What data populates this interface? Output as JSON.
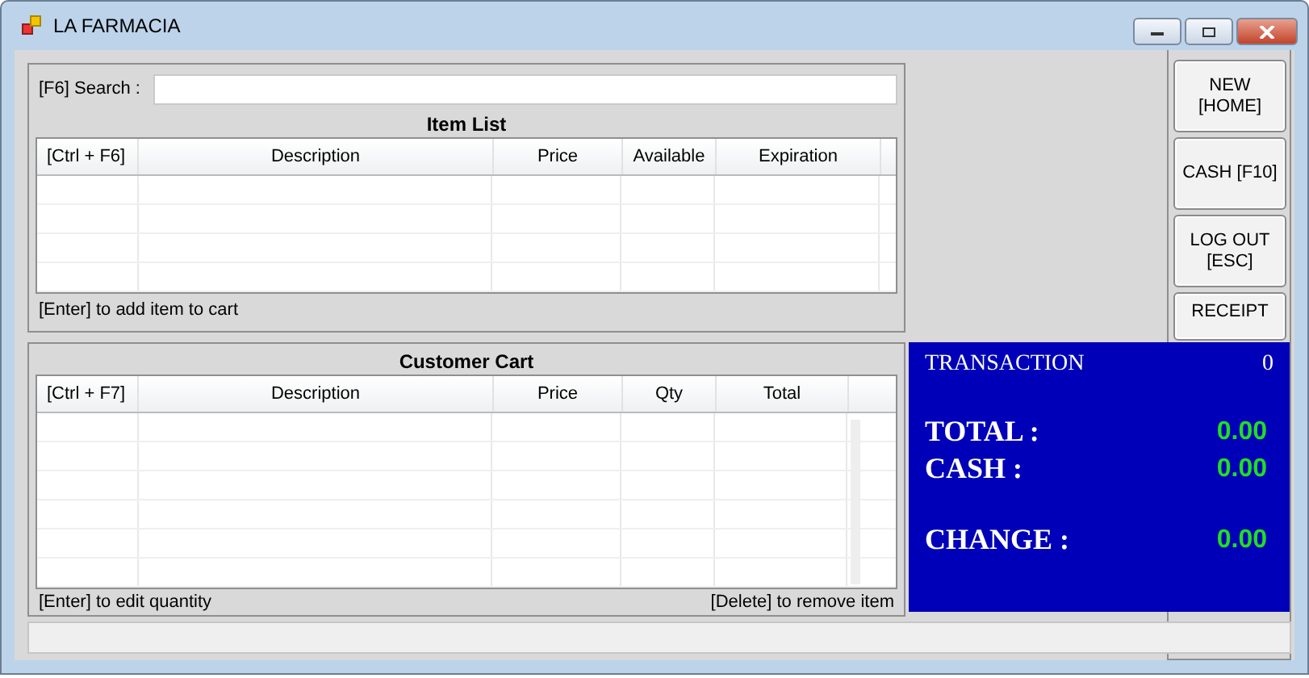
{
  "window": {
    "title": "LA FARMACIA"
  },
  "search": {
    "label": "[F6] Search :"
  },
  "item_list": {
    "title": "Item List",
    "columns": [
      "[Ctrl + F6]",
      "Description",
      "Price",
      "Available",
      "Expiration"
    ],
    "hint": "[Enter] to add item to cart"
  },
  "customer_cart": {
    "title": "Customer Cart",
    "columns": [
      "[Ctrl + F7]",
      "Description",
      "Price",
      "Qty",
      "Total"
    ],
    "hints": [
      "[Enter] to edit quantity",
      "[Delete] to remove item"
    ]
  },
  "buttons": [
    "NEW\n[HOME]",
    "CASH [F10]",
    "LOG OUT\n[ESC]",
    "RECEIPT"
  ],
  "transaction": {
    "label": "TRANSACTION",
    "count": "0",
    "lines": [
      {
        "label": "TOTAL :",
        "value": "0.00"
      },
      {
        "label": "CASH :",
        "value": "0.00"
      },
      {
        "label": "CHANGE :",
        "value": "0.00"
      }
    ]
  }
}
